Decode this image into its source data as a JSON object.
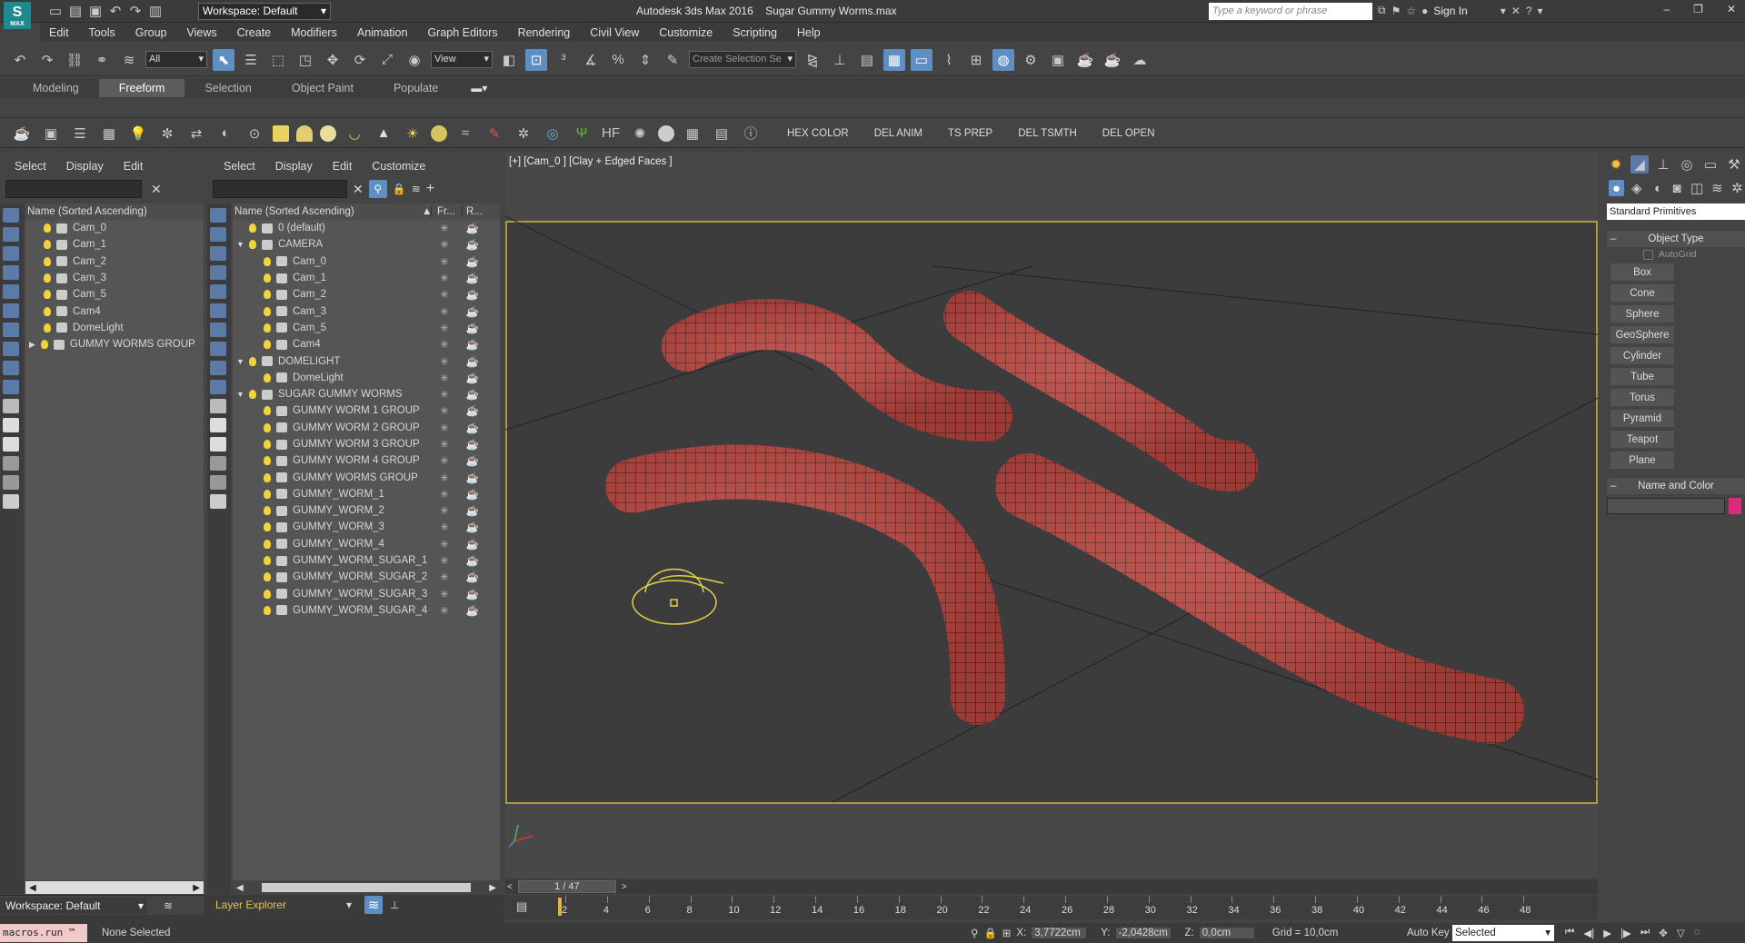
{
  "title": {
    "app": "Autodesk 3ds Max 2016",
    "file": "Sugar Gummy Worms.max",
    "workspace": "Workspace: Default",
    "search_placeholder": "Type a keyword or phrase",
    "signin": "Sign In",
    "logo": "MAX"
  },
  "menu": [
    "Edit",
    "Tools",
    "Group",
    "Views",
    "Create",
    "Modifiers",
    "Animation",
    "Graph Editors",
    "Rendering",
    "Civil View",
    "Customize",
    "Scripting",
    "Help"
  ],
  "toolbar": {
    "filter": "All",
    "refsys": "View",
    "selset": "Create Selection Se"
  },
  "ribbon": {
    "tabs": [
      "Modeling",
      "Freeform",
      "Selection",
      "Object Paint",
      "Populate"
    ],
    "active": "Freeform"
  },
  "shelf": {
    "scripts": [
      "HEX COLOR",
      "DEL ANIM",
      "TS PREP",
      "DEL TSMTH",
      "DEL OPEN"
    ]
  },
  "scene1": {
    "tabs": [
      "Select",
      "Display",
      "Edit"
    ],
    "header": "Name (Sorted Ascending)",
    "items": [
      "Cam_0",
      "Cam_1",
      "Cam_2",
      "Cam_3",
      "Cam_5",
      "Cam4",
      "DomeLight",
      "GUMMY WORMS GROUP"
    ],
    "footer": "Workspace: Default"
  },
  "scene2": {
    "tabs": [
      "Select",
      "Display",
      "Edit",
      "Customize"
    ],
    "header": "Name (Sorted Ascending)",
    "col2": "Fr...",
    "col3": "R...",
    "items": [
      {
        "name": "0 (default)",
        "ind": 0,
        "exp": ""
      },
      {
        "name": "CAMERA",
        "ind": 0,
        "exp": "▼"
      },
      {
        "name": "Cam_0",
        "ind": 1,
        "exp": ""
      },
      {
        "name": "Cam_1",
        "ind": 1,
        "exp": ""
      },
      {
        "name": "Cam_2",
        "ind": 1,
        "exp": ""
      },
      {
        "name": "Cam_3",
        "ind": 1,
        "exp": ""
      },
      {
        "name": "Cam_5",
        "ind": 1,
        "exp": ""
      },
      {
        "name": "Cam4",
        "ind": 1,
        "exp": ""
      },
      {
        "name": "DOMELIGHT",
        "ind": 0,
        "exp": "▼"
      },
      {
        "name": "DomeLight",
        "ind": 1,
        "exp": ""
      },
      {
        "name": "SUGAR GUMMY WORMS",
        "ind": 0,
        "exp": "▼"
      },
      {
        "name": "GUMMY WORM 1 GROUP",
        "ind": 1,
        "exp": ""
      },
      {
        "name": "GUMMY WORM 2 GROUP",
        "ind": 1,
        "exp": ""
      },
      {
        "name": "GUMMY WORM 3 GROUP",
        "ind": 1,
        "exp": ""
      },
      {
        "name": "GUMMY WORM 4 GROUP",
        "ind": 1,
        "exp": ""
      },
      {
        "name": "GUMMY WORMS GROUP",
        "ind": 1,
        "exp": ""
      },
      {
        "name": "GUMMY_WORM_1",
        "ind": 1,
        "exp": ""
      },
      {
        "name": "GUMMY_WORM_2",
        "ind": 1,
        "exp": ""
      },
      {
        "name": "GUMMY_WORM_3",
        "ind": 1,
        "exp": ""
      },
      {
        "name": "GUMMY_WORM_4",
        "ind": 1,
        "exp": ""
      },
      {
        "name": "GUMMY_WORM_SUGAR_1",
        "ind": 1,
        "exp": ""
      },
      {
        "name": "GUMMY_WORM_SUGAR_2",
        "ind": 1,
        "exp": ""
      },
      {
        "name": "GUMMY_WORM_SUGAR_3",
        "ind": 1,
        "exp": ""
      },
      {
        "name": "GUMMY_WORM_SUGAR_4",
        "ind": 1,
        "exp": ""
      }
    ],
    "footer": "Layer Explorer"
  },
  "viewport": {
    "label": "[+] [Cam_0 ] [Clay + Edged Faces ]"
  },
  "cmd": {
    "dropdown": "Standard Primitives",
    "object_type": "Object Type",
    "autogrid": "AutoGrid",
    "buttons": [
      "Box",
      "Cone",
      "Sphere",
      "GeoSphere",
      "Cylinder",
      "Tube",
      "Torus",
      "Pyramid",
      "Teapot",
      "Plane"
    ],
    "name_color": "Name and Color"
  },
  "timeline": {
    "frame": "1 / 47",
    "ticks": [
      "2",
      "4",
      "6",
      "8",
      "10",
      "12",
      "14",
      "16",
      "18",
      "20",
      "22",
      "24",
      "26",
      "28",
      "30",
      "32",
      "34",
      "36",
      "38",
      "40",
      "42",
      "44",
      "46",
      "48"
    ]
  },
  "status": {
    "macro": "macros.run ™",
    "selected": "None Selected",
    "x_label": "X:",
    "x": "3,7722cm",
    "y_label": "Y:",
    "y": "-2,0428cm",
    "z_label": "Z:",
    "z": "0,0cm",
    "grid": "Grid = 10,0cm",
    "autokey": "Auto Key",
    "keymode": "Selected"
  },
  "colors": {
    "accent": "#5d8fc3",
    "worm": "#b8443e",
    "selection": "#c9b93a"
  }
}
